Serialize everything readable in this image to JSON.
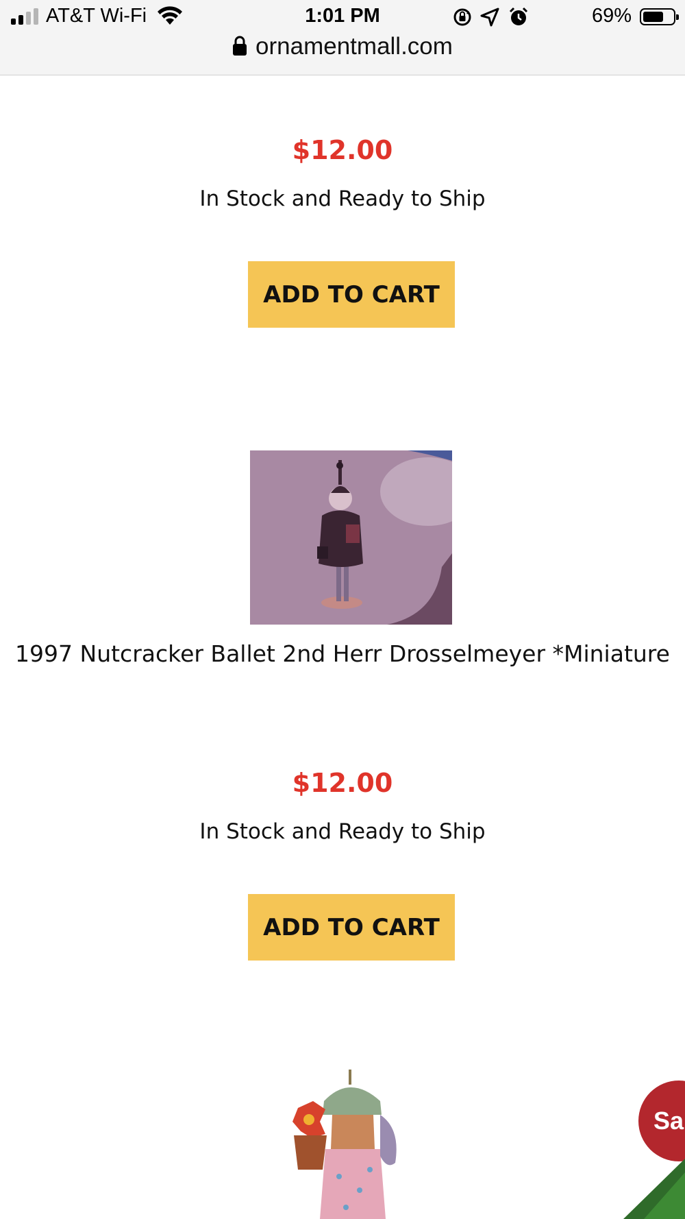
{
  "status_bar": {
    "carrier": "AT&T Wi-Fi",
    "time": "1:01 PM",
    "battery_percent": "69%",
    "battery_level": 0.69,
    "signal_bars_active": 2,
    "icons": [
      "signal-icon",
      "wifi-icon",
      "rotation-lock-icon",
      "location-icon",
      "alarm-icon",
      "battery-icon"
    ]
  },
  "browser": {
    "url": "ornamentmall.com",
    "icons": [
      "lock-icon"
    ]
  },
  "products": [
    {
      "price": "$12.00",
      "stock": "In Stock and Ready to Ship",
      "button": "ADD TO CART"
    },
    {
      "title": "1997 Nutcracker Ballet 2nd Herr Drosselmeyer *Miniature",
      "price": "$12.00",
      "stock": "In Stock and Ready to Ship",
      "button": "ADD TO CART"
    }
  ],
  "chat_widget": {
    "label": "Sa"
  },
  "colors": {
    "price": "#e0342a",
    "button": "#f5c555",
    "chat": "#b3272d"
  }
}
